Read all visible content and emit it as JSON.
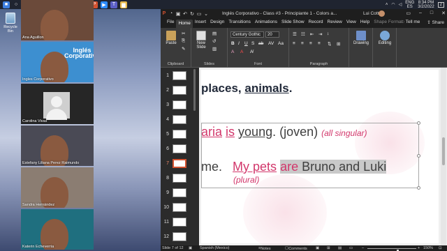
{
  "desktop": {
    "recycle_label": "Recycle Bin"
  },
  "taskbar": {
    "icons": [
      {
        "name": "start-icon",
        "glyph": "■",
        "color": "#3d7fe0"
      },
      {
        "name": "search-icon",
        "glyph": "○",
        "color": "#1f2430"
      },
      {
        "name": "task-view-icon",
        "glyph": "▭",
        "color": "#1f2430"
      },
      {
        "name": "edge-icon",
        "glyph": "e",
        "color": "#1778c8"
      },
      {
        "name": "word-icon",
        "glyph": "W",
        "color": "#2b579a"
      },
      {
        "name": "skype-icon",
        "glyph": "S",
        "color": "#00aff0"
      },
      {
        "name": "excel-icon",
        "glyph": "X",
        "color": "#217346"
      },
      {
        "name": "whatsapp-icon",
        "glyph": "◉",
        "color": "#25d366"
      },
      {
        "name": "chrome-icon",
        "glyph": "●",
        "color": "#de5246"
      },
      {
        "name": "powerpoint-icon",
        "glyph": "P",
        "color": "#d35230"
      },
      {
        "name": "zoom-icon",
        "glyph": "▶",
        "color": "#2d8cff"
      },
      {
        "name": "teams-icon",
        "glyph": "T",
        "color": "#5b5fc7"
      },
      {
        "name": "folder-icon",
        "glyph": "▆",
        "color": "#e8b84a"
      }
    ],
    "lang_top": "ENG",
    "lang_bottom": "ES",
    "time": "8:34 PM",
    "date": "3/2/2022",
    "notifications": "2"
  },
  "gallery": [
    {
      "name": "Ana Aguillon",
      "bg": "#6b4a3a"
    },
    {
      "name": "Ingles Corporativo",
      "bg": "#3d8fd0",
      "brand": "Inglés Corporativo"
    },
    {
      "name": "Carolina Vivas",
      "bg": "#262626",
      "avatar": true
    },
    {
      "name": "Estefany Liliana Perez Raimundo",
      "bg": "#4a4a55"
    },
    {
      "name": "Sandra Hernández",
      "bg": "#8b7d72"
    },
    {
      "name": "Katerin Echeverria",
      "bg": "#1f6f7f"
    }
  ],
  "ppt": {
    "doc_title": "Inglés Corporativo - Class #3 - Principiante 1 - Colors a...",
    "user": "Lui Cotto",
    "tabs": [
      "File",
      "Home",
      "Insert",
      "Design",
      "Transitions",
      "Animations",
      "Slide Show",
      "Record",
      "Review",
      "View",
      "Help",
      "Shape Format"
    ],
    "active_tab": "Home",
    "tell_me": "Tell me",
    "share": "Share",
    "ribbon": {
      "paste": "Paste",
      "new_slide": "New Slide",
      "font_name": "Century Gothic",
      "font_size": "20",
      "drawing": "Drawing",
      "editing": "Editing",
      "groups": {
        "clipboard": "Clipboard",
        "slides": "Slides",
        "font": "Font",
        "paragraph": "Paragraph"
      }
    },
    "slides": [
      "1",
      "2",
      "3",
      "4",
      "5",
      "6",
      "7",
      "8",
      "9",
      "10",
      "11",
      "12"
    ],
    "selected_slide": "7",
    "slide": {
      "heading_prefix": "places, ",
      "heading_animals": "animals",
      "heading_end": ".",
      "line1_maria": "aria",
      "line1_is": "is",
      "line1_young": "young",
      "line1_rest": ". (joven)",
      "line1_note": "(all singular)",
      "line2_me": "me.",
      "line2_my_pets": "My pets",
      "line2_are": "are",
      "line2_names": "Bruno and Luki",
      "line2_plural": "(plural)"
    },
    "status": {
      "slide_info": "Slide 7 of 12",
      "language": "Spanish (Mexico)",
      "notes": "Notes",
      "comments": "Comments",
      "zoom": "150%",
      "zoom_level": 0.62
    }
  }
}
